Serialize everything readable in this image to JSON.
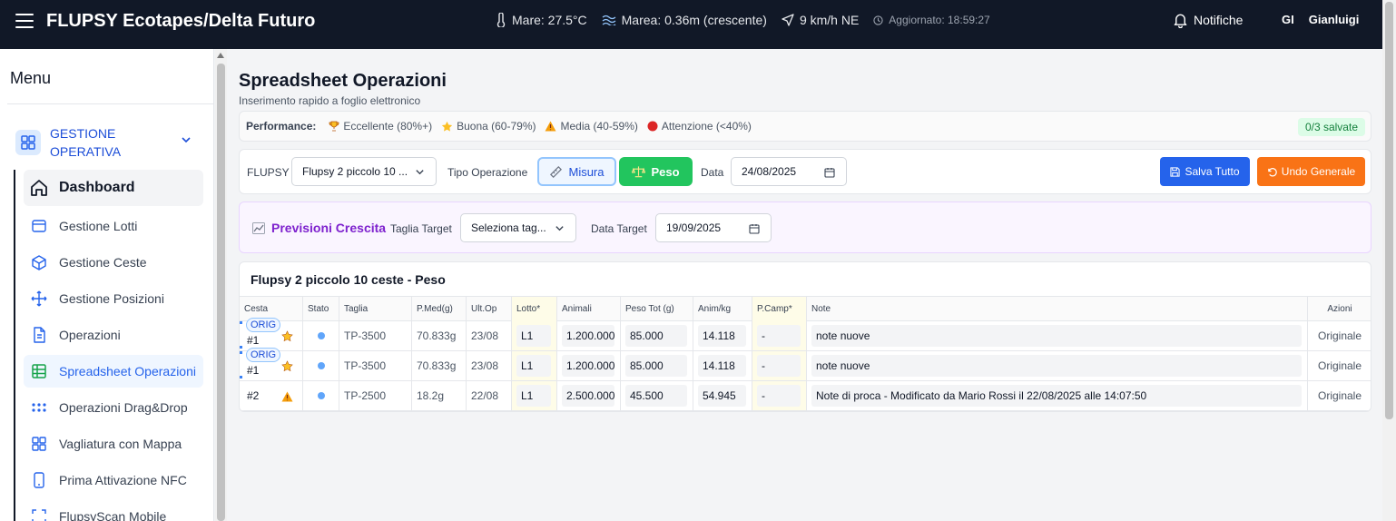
{
  "header": {
    "title": "FLUPSY Ecotapes/Delta Futuro",
    "sea_temp": "Mare: 27.5°C",
    "tide": "Marea: 0.36m (crescente)",
    "wind": "9 km/h NE",
    "updated": "Aggiornato: 18:59:27",
    "notifications": "Notifiche",
    "user_initials": "GI",
    "user_name": "Gianluigi"
  },
  "sidebar": {
    "title": "Menu",
    "group_label": "GESTIONE OPERATIVA",
    "items": [
      {
        "label": "Dashboard",
        "icon": "home-icon"
      },
      {
        "label": "Gestione Lotti",
        "icon": "box-icon"
      },
      {
        "label": "Gestione Ceste",
        "icon": "cube-icon"
      },
      {
        "label": "Gestione Posizioni",
        "icon": "move-icon"
      },
      {
        "label": "Operazioni",
        "icon": "file-icon"
      },
      {
        "label": "Spreadsheet Operazioni",
        "icon": "table-icon"
      },
      {
        "label": "Operazioni Drag&Drop",
        "icon": "grip-icon"
      },
      {
        "label": "Vagliatura con Mappa",
        "icon": "grid-icon"
      },
      {
        "label": "Prima Attivazione NFC",
        "icon": "phone-icon"
      },
      {
        "label": "FlupsyScan Mobile",
        "icon": "scan-icon"
      }
    ]
  },
  "page": {
    "title": "Spreadsheet Operazioni",
    "subtitle": "Inserimento rapido a foglio elettronico"
  },
  "performance": {
    "label": "Performance:",
    "items": [
      {
        "icon": "trophy-icon",
        "text": "Eccellente (80%+)"
      },
      {
        "icon": "star-icon",
        "text": "Buona (60-79%)"
      },
      {
        "icon": "warning-icon",
        "text": "Media (40-59%)"
      },
      {
        "icon": "red-dot-icon",
        "text": "Attenzione (<40%)"
      }
    ],
    "saved": "0/3 salvate"
  },
  "toolbar": {
    "flupsy_label": "FLUPSY",
    "flupsy_value": "Flupsy 2 piccolo 10 ...",
    "tipo_label": "Tipo Operazione",
    "misura_label": "Misura",
    "peso_label": "Peso",
    "data_label": "Data",
    "data_value": "24/08/2025",
    "save_label": "Salva Tutto",
    "undo_label": "Undo Generale"
  },
  "forecast": {
    "title": "Previsioni Crescita",
    "taglia_label": "Taglia Target",
    "taglia_placeholder": "Seleziona tag...",
    "data_label": "Data Target",
    "data_value": "19/09/2025"
  },
  "table": {
    "title": "Flupsy 2 piccolo 10 ceste - Peso",
    "headers": [
      "Cesta",
      "Stato",
      "Taglia",
      "P.Med(g)",
      "Ult.Op",
      "Lotto*",
      "Animali",
      "Peso Tot (g)",
      "Anim/kg",
      "P.Camp*",
      "Note",
      "Azioni"
    ],
    "rows": [
      {
        "badge": "ORIG",
        "cesta": "#1",
        "perf": "star",
        "taglia": "TP-3500",
        "pmed": "70.833g",
        "ultop": "23/08",
        "lotto": "L1",
        "animali": "1.200.000",
        "peso": "85.000",
        "animkg": "14.118",
        "pcamp": "-",
        "note": "note nuove",
        "azioni": "Originale"
      },
      {
        "badge": "ORIG",
        "cesta": "#1",
        "perf": "star",
        "taglia": "TP-3500",
        "pmed": "70.833g",
        "ultop": "23/08",
        "lotto": "L1",
        "animali": "1.200.000",
        "peso": "85.000",
        "animkg": "14.118",
        "pcamp": "-",
        "note": "note nuove",
        "azioni": "Originale"
      },
      {
        "badge": "",
        "cesta": "#2",
        "perf": "warning",
        "taglia": "TP-2500",
        "pmed": "18.2g",
        "ultop": "22/08",
        "lotto": "L1",
        "animali": "2.500.000",
        "peso": "45.500",
        "animkg": "54.945",
        "pcamp": "-",
        "note": "Note di proca - Modificato da Mario Rossi il 22/08/2025 alle 14:07:50",
        "azioni": "Originale"
      }
    ]
  },
  "colors": {
    "topbar": "#111827",
    "accent_blue": "#2563eb",
    "peso_green": "#22c55e",
    "undo_orange": "#f97316",
    "forecast_purple": "#7e22ce"
  }
}
